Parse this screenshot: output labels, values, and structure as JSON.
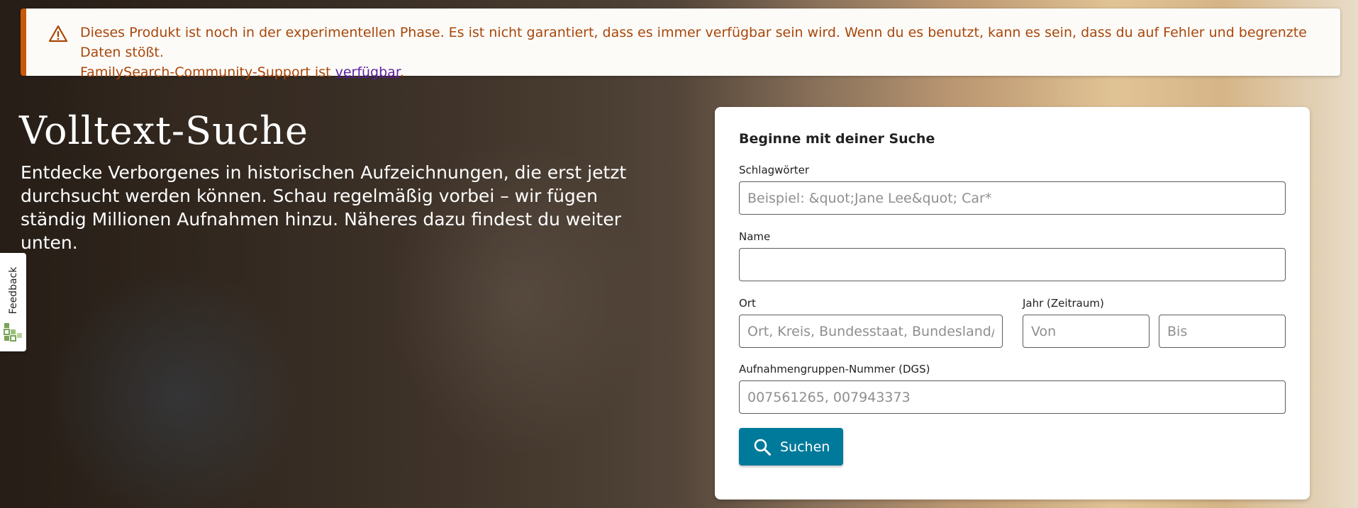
{
  "banner": {
    "message": "Dieses Produkt ist noch in der experimentellen Phase. Es ist nicht garantiert, dass es immer verfügbar sein wird. Wenn du es benutzt, kann es sein, dass du auf Fehler und begrenzte Daten stößt.",
    "support_prefix": "FamilySearch-Community-Support ist ",
    "support_link": "verfügbar",
    "support_suffix": ".",
    "icon": "warning-icon",
    "accent_color": "#c8590b"
  },
  "hero": {
    "title": "Volltext-Suche",
    "description": "Entdecke Verborgenes in historischen Aufzeichnungen, die erst jetzt durchsucht werden können. Schau regelmäßig vorbei – wir fügen ständig Millionen Aufnahmen hinzu. Näheres dazu findest du weiter unten."
  },
  "feedback": {
    "label": "Feedback",
    "icon": "feedback-icon"
  },
  "search_form": {
    "title": "Beginne mit deiner Suche",
    "keywords": {
      "label": "Schlagwörter",
      "placeholder": "Beispiel: &quot;Jane Lee&quot; Car*",
      "value": ""
    },
    "name": {
      "label": "Name",
      "placeholder": "",
      "value": ""
    },
    "place": {
      "label": "Ort",
      "placeholder": "Ort, Kreis, Bundesstaat, Bundesland/Kanton, Land",
      "value": ""
    },
    "year_range": {
      "label": "Jahr (Zeitraum)",
      "from_placeholder": "Von",
      "to_placeholder": "Bis"
    },
    "dgs": {
      "label": "Aufnahmengruppen-Nummer (DGS)",
      "placeholder": "007561265, 007943373",
      "value": ""
    },
    "submit_label": "Suchen",
    "submit_icon": "search-icon",
    "button_color": "#007a9a"
  }
}
